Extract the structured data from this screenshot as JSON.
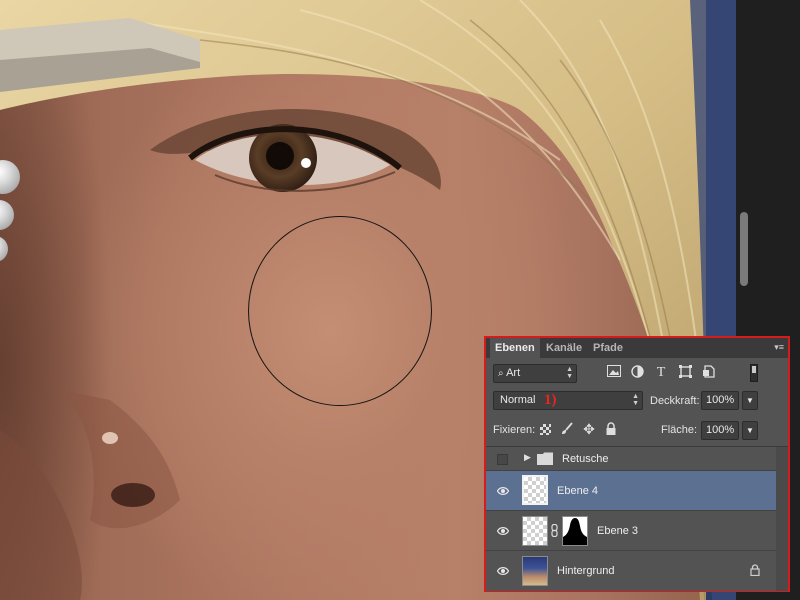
{
  "panel": {
    "tabs": [
      "Ebenen",
      "Kanäle",
      "Pfade"
    ],
    "active_tab": "Ebenen",
    "menu_glyph": "▾≡",
    "filter": {
      "kind": "Art"
    },
    "blend_mode": "Normal",
    "annotation": "1)",
    "opacity_label": "Deckkraft:",
    "opacity_value": "100%",
    "lock_label": "Fixieren:",
    "fill_label": "Fläche:",
    "fill_value": "100%",
    "layers": [
      {
        "name": "Retusche",
        "type": "group",
        "visible": false,
        "selected": false
      },
      {
        "name": "Ebene 4",
        "type": "pixel",
        "visible": true,
        "selected": true
      },
      {
        "name": "Ebene 3",
        "type": "pixel-with-mask",
        "visible": true,
        "selected": false
      },
      {
        "name": "Hintergrund",
        "type": "background",
        "visible": true,
        "selected": false,
        "locked": true
      }
    ]
  },
  "colors": {
    "panel_bg": "#535353",
    "selection": "#5c7192",
    "highlight_border": "#d51b1b",
    "annotation": "#e8261f"
  },
  "icons": {
    "filter": [
      "image-filter-icon",
      "adjustment-filter-icon",
      "type-filter-icon",
      "shape-filter-icon",
      "smart-object-filter-icon"
    ],
    "lock": [
      "lock-transparent-icon",
      "lock-pixels-icon",
      "lock-position-icon",
      "lock-all-icon"
    ]
  }
}
